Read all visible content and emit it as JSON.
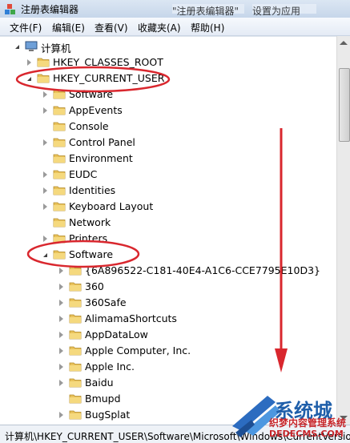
{
  "window": {
    "title": "注册表编辑器",
    "ghost_title_parts": [
      "\"注册表编辑器\"",
      "设置为应用"
    ]
  },
  "menu": [
    "文件(F)",
    "编辑(E)",
    "查看(V)",
    "收藏夹(A)",
    "帮助(H)"
  ],
  "tree": {
    "root_label": "计算机",
    "nodes": [
      {
        "label": "HKEY_CLASSES_ROOT",
        "level": 1,
        "state": "collapsed"
      },
      {
        "label": "HKEY_CURRENT_USER",
        "level": 1,
        "state": "expanded"
      },
      {
        "label": " Software",
        "level": 2,
        "state": "collapsed"
      },
      {
        "label": "AppEvents",
        "level": 2,
        "state": "collapsed"
      },
      {
        "label": "Console",
        "level": 2,
        "state": "none"
      },
      {
        "label": "Control Panel",
        "level": 2,
        "state": "collapsed"
      },
      {
        "label": "Environment",
        "level": 2,
        "state": "none"
      },
      {
        "label": "EUDC",
        "level": 2,
        "state": "collapsed"
      },
      {
        "label": "Identities",
        "level": 2,
        "state": "collapsed"
      },
      {
        "label": "Keyboard Layout",
        "level": 2,
        "state": "collapsed"
      },
      {
        "label": "Network",
        "level": 2,
        "state": "none"
      },
      {
        "label": "Printers",
        "level": 2,
        "state": "collapsed"
      },
      {
        "label": "Software",
        "level": 2,
        "state": "expanded"
      },
      {
        "label": "{6A896522-C181-40E4-A1C6-CCE7795E10D3}",
        "level": 3,
        "state": "collapsed"
      },
      {
        "label": "360",
        "level": 3,
        "state": "collapsed"
      },
      {
        "label": "360Safe",
        "level": 3,
        "state": "collapsed"
      },
      {
        "label": "AlimamaShortcuts",
        "level": 3,
        "state": "collapsed"
      },
      {
        "label": "AppDataLow",
        "level": 3,
        "state": "collapsed"
      },
      {
        "label": "Apple Computer, Inc.",
        "level": 3,
        "state": "collapsed"
      },
      {
        "label": "Apple Inc.",
        "level": 3,
        "state": "collapsed"
      },
      {
        "label": "Baidu",
        "level": 3,
        "state": "collapsed"
      },
      {
        "label": "Bmupd",
        "level": 3,
        "state": "none"
      },
      {
        "label": "BugSplat",
        "level": 3,
        "state": "collapsed"
      }
    ]
  },
  "status": {
    "path": "计算机\\HKEY_CURRENT_USER\\Software\\Microsoft\\Windows\\CurrentVersion\\"
  },
  "watermark": {
    "brand": "系统城",
    "subtitle": "织梦内容管理系统",
    "domain": "DEDECMS.COM"
  },
  "colors": {
    "folder": "#e9c25a",
    "annotation": "#d9272e",
    "accent": "#1f5faa"
  }
}
